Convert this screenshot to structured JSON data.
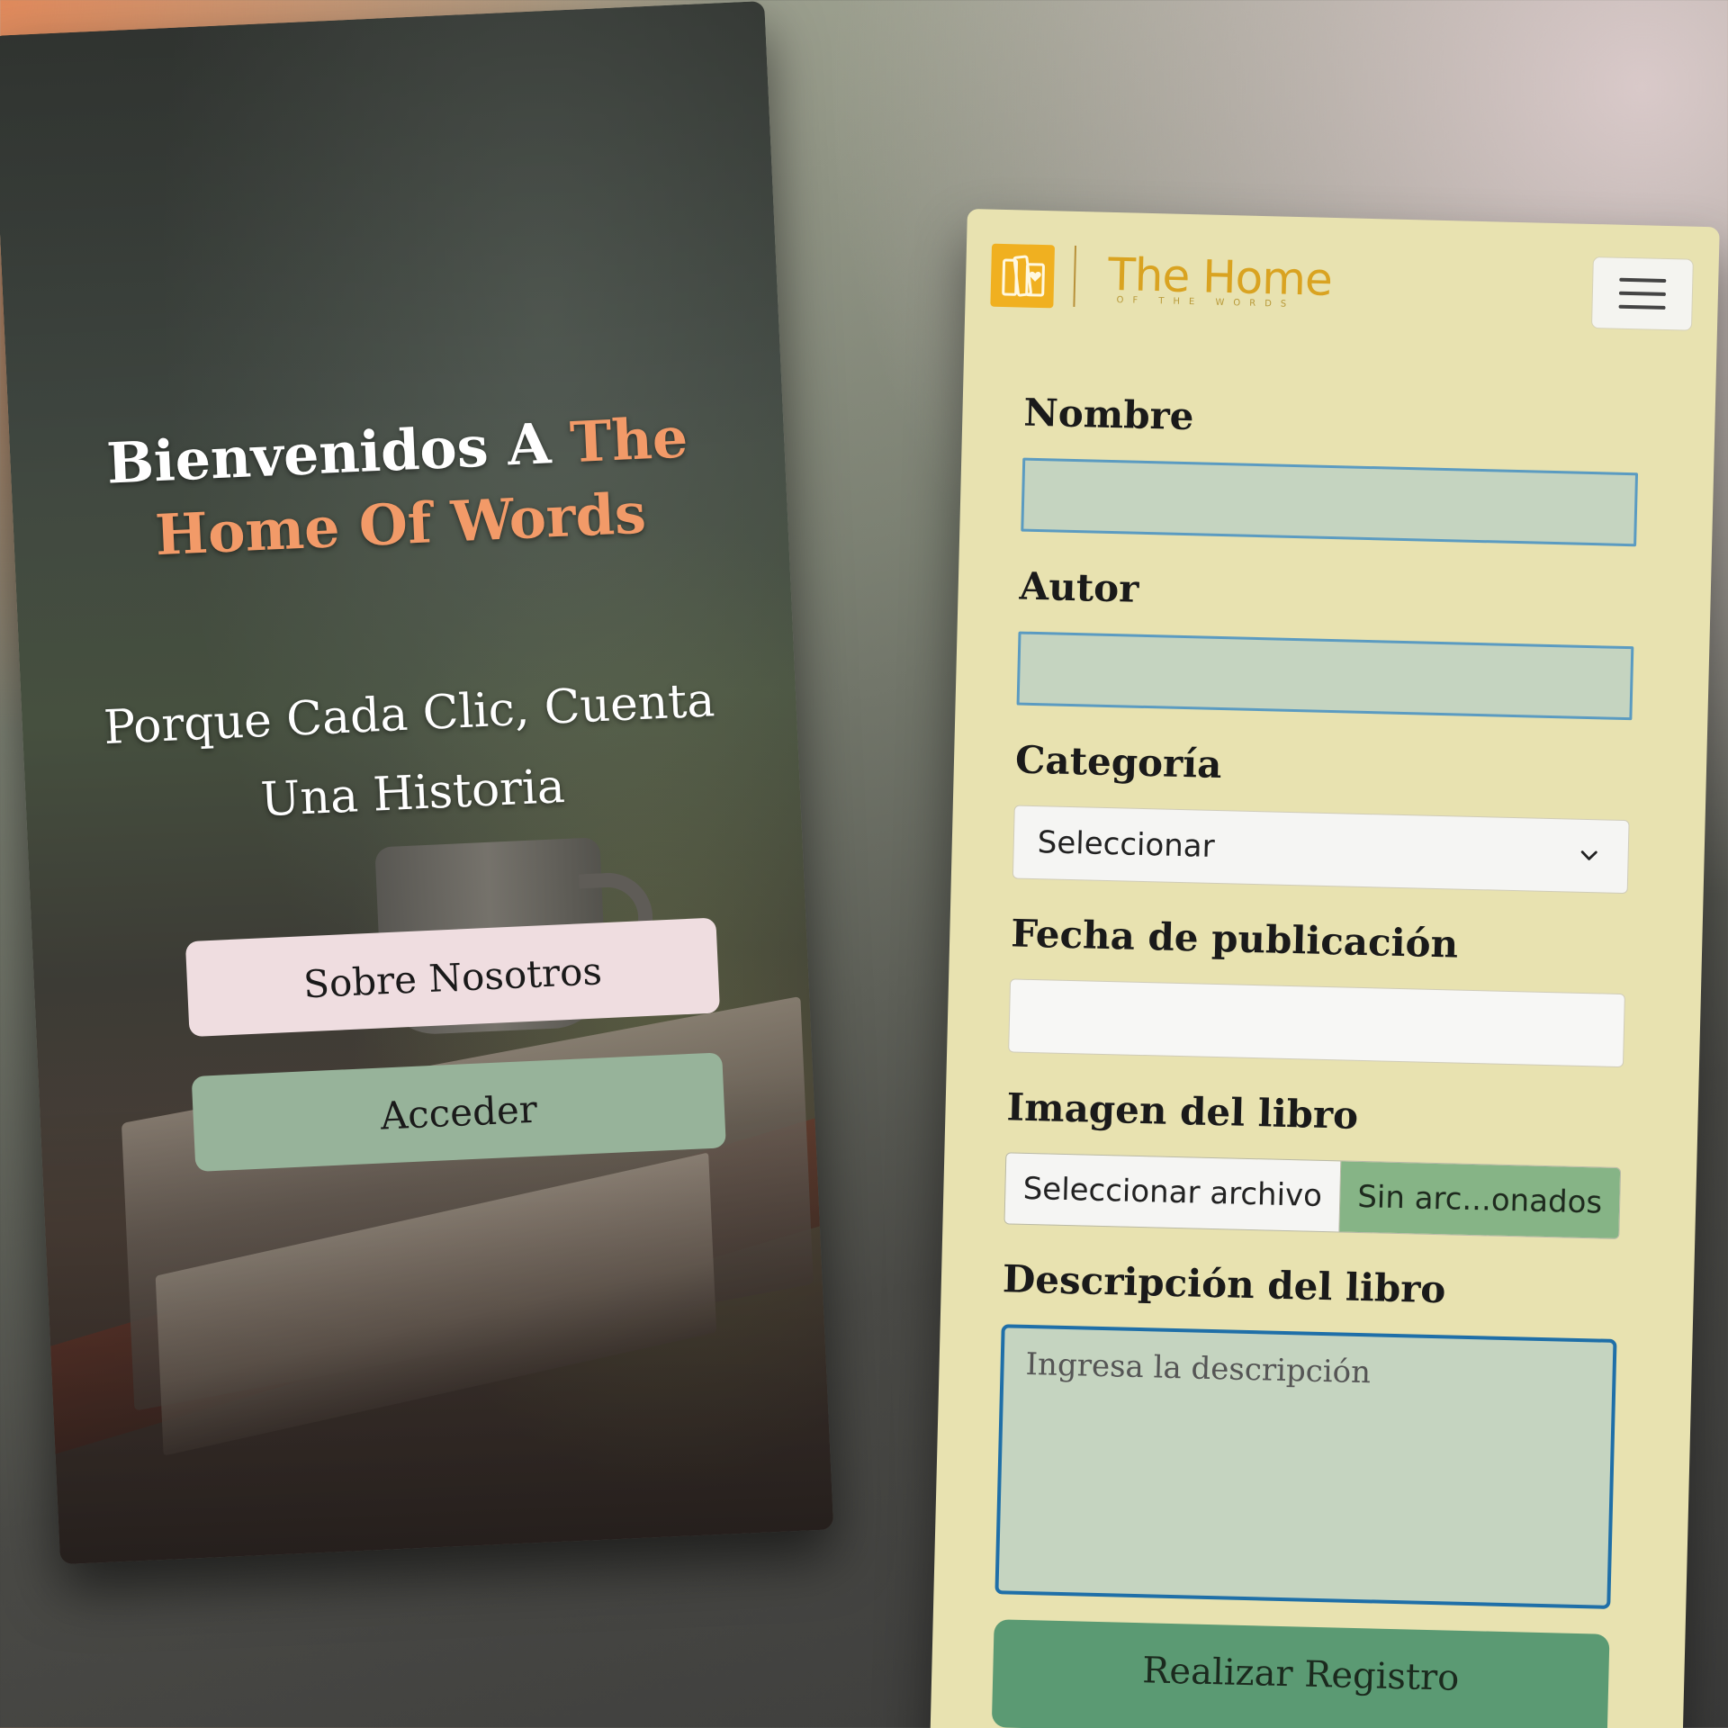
{
  "landing": {
    "title_white": "Bienvenidos A ",
    "title_accent": "The Home Of Words",
    "subtitle": "Porque Cada Clic, Cuenta Una Historia",
    "about_button": "Sobre Nosotros",
    "access_button": "Acceder",
    "accent_color": "#f29a68"
  },
  "form_screen": {
    "brand": {
      "logo_icon": "book-heart-icon",
      "name": "The Home",
      "tagline": "OF THE WORDS",
      "color": "#d9a321"
    },
    "menu_icon": "hamburger-menu-icon",
    "fields": {
      "nombre_label": "Nombre",
      "autor_label": "Autor",
      "categoria_label": "Categoría",
      "categoria_value": "Seleccionar",
      "fecha_label": "Fecha de publicación",
      "imagen_label": "Imagen del libro",
      "file_button": "Seleccionar archivo",
      "file_status": "Sin arc...onados",
      "descripcion_label": "Descripción del libro",
      "descripcion_placeholder": "Ingresa la descripción"
    },
    "submit_button": "Realizar Registro",
    "colors": {
      "background": "#e8e2b0",
      "input_fill": "#c5d4c0",
      "input_border": "#5b9bc1",
      "file_status_bg": "#86b486",
      "submit_bg": "#5b9a73"
    }
  }
}
